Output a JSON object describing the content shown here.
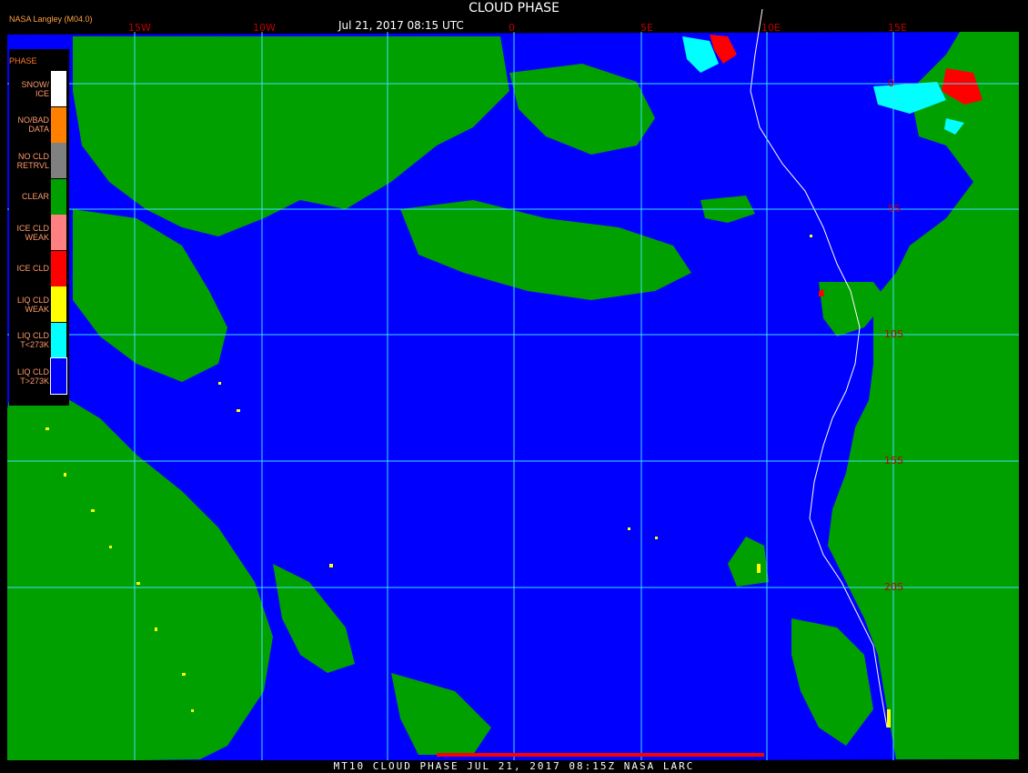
{
  "header": {
    "title": "CLOUD PHASE",
    "time": "Jul 21, 2017 08:15 UTC",
    "agency": "NASA Langley (M04.0)"
  },
  "footer": {
    "text": "MT10  CLOUD PHASE  JUL 21, 2017 08:15Z  NASA LARC"
  },
  "legend": {
    "title": "PHASE",
    "items": [
      {
        "label": "SNOW/\nICE",
        "color": "#ffffff"
      },
      {
        "label": "NO/BAD\nDATA",
        "color": "#ff8000"
      },
      {
        "label": "NO CLD\nRETRVL",
        "color": "#808080"
      },
      {
        "label": "CLEAR",
        "color": "#00a000"
      },
      {
        "label": "ICE CLD\nWEAK",
        "color": "#ff8080"
      },
      {
        "label": "ICE CLD",
        "color": "#ff0000"
      },
      {
        "label": "LIQ CLD\nWEAK",
        "color": "#ffff00"
      },
      {
        "label": "LIQ CLD\nT<273K",
        "color": "#00ffff"
      },
      {
        "label": "LIQ CLD\nT>273K",
        "color": "#0000ff"
      }
    ]
  },
  "grid": {
    "lon_labels": [
      "15W",
      "10W",
      "0",
      "5E",
      "10E",
      "15E"
    ],
    "lat_labels": [
      "0",
      "5S",
      "10S",
      "15S",
      "20S"
    ]
  },
  "colors": {
    "ocean": "#0000ff",
    "land_clear": "#00a000",
    "grid": "#40e0ff",
    "coast": "#ffffff",
    "label": "#c00000"
  }
}
